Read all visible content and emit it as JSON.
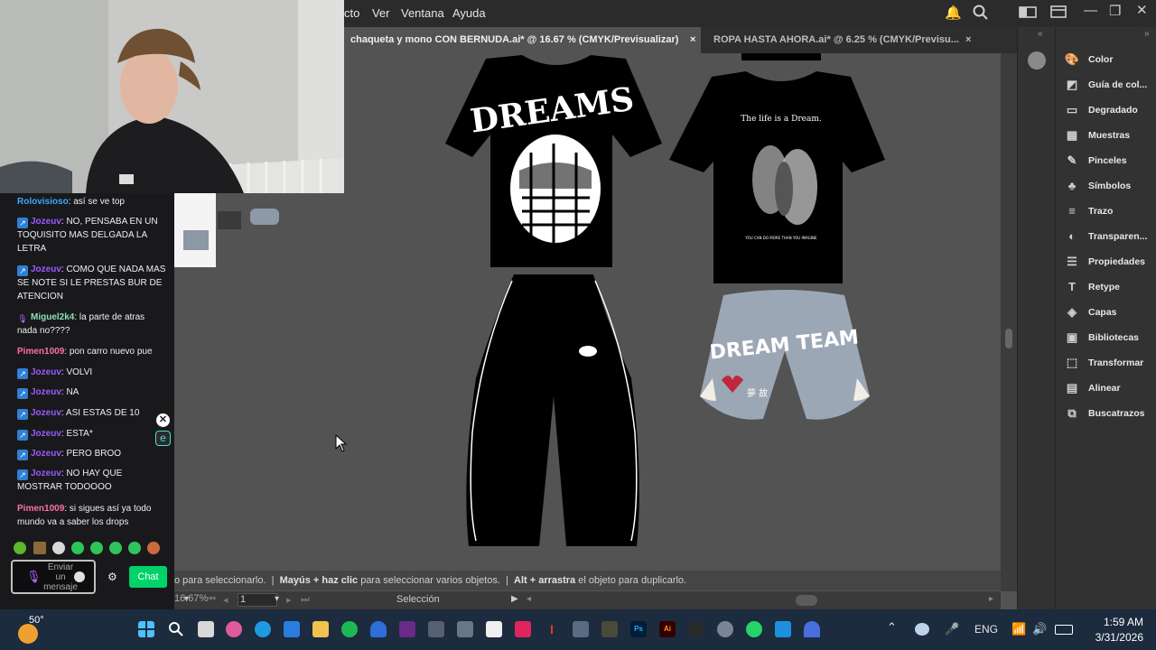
{
  "menubar": {
    "items": [
      "cto",
      "Ver",
      "Ventana",
      "Ayuda"
    ]
  },
  "tabs": [
    {
      "label": "chaqueta y mono CON BERNUDA.ai* @ 16.67 % (CMYK/Previsualizar)",
      "close": "×"
    },
    {
      "label": "ROPA HASTA AHORA.ai* @ 6.25 % (CMYK/Previsu...",
      "close": "×"
    }
  ],
  "artwork": {
    "tshirt1_text": "DREAMS",
    "tshirt2_title": "The life is a Dream.",
    "tshirt2_caption": "YOU CAN DO MORE THAN YOU IMAGINE",
    "shorts_text": "DREAM TEAM",
    "shorts_glyphs": "夢 故"
  },
  "statusbar": {
    "part1": "o para seleccionarlo.",
    "part2_bold": "Mayús + haz clic",
    "part2": " para seleccionar varios objetos.",
    "part3_bold": "Alt + arrastra",
    "part3": " el objeto para duplicarlo."
  },
  "bottombar": {
    "zoom": "16.67%",
    "page": "1",
    "tool": "Selección"
  },
  "panel": {
    "items": [
      {
        "label": "Color",
        "icon": "palette-icon",
        "glyph": "🎨"
      },
      {
        "label": "Guía de col...",
        "icon": "color-guide-icon",
        "glyph": "◩"
      },
      {
        "label": "Degradado",
        "icon": "gradient-icon",
        "glyph": "▭"
      },
      {
        "label": "Muestras",
        "icon": "swatches-icon",
        "glyph": "▦"
      },
      {
        "label": "Pinceles",
        "icon": "brush-icon",
        "glyph": "✎"
      },
      {
        "label": "Símbolos",
        "icon": "symbols-icon",
        "glyph": "♣"
      },
      {
        "label": "Trazo",
        "icon": "stroke-icon",
        "glyph": "≡"
      },
      {
        "label": "Transparen...",
        "icon": "transparency-icon",
        "glyph": "◐"
      },
      {
        "label": "Propiedades",
        "icon": "properties-icon",
        "glyph": "☰"
      },
      {
        "label": "Retype",
        "icon": "retype-icon",
        "glyph": "T"
      },
      {
        "label": "Capas",
        "icon": "layers-icon",
        "glyph": "◈"
      },
      {
        "label": "Bibliotecas",
        "icon": "libraries-icon",
        "glyph": "▣"
      },
      {
        "label": "Transformar",
        "icon": "transform-icon",
        "glyph": "⬚"
      },
      {
        "label": "Alinear",
        "icon": "align-icon",
        "glyph": "▤"
      },
      {
        "label": "Buscatrazos",
        "icon": "pathfinder-icon",
        "glyph": "⧉"
      }
    ]
  },
  "chat": {
    "messages": [
      {
        "user": "Rolovisioso",
        "user_class": "u-rolo",
        "badge": "",
        "text": ": así se ve top"
      },
      {
        "user": "Jozeuv",
        "user_class": "u-jozeuv",
        "badge": "sub",
        "text": ": NO, PENSABA EN UN TOQUISITO MAS DELGADA LA LETRA"
      },
      {
        "user": "Jozeuv",
        "user_class": "u-jozeuv",
        "badge": "sub",
        "text": ": COMO QUE NADA MAS SE NOTE SI LE PRESTAS BUR DE ATENCION"
      },
      {
        "user": "Miguel2k4",
        "user_class": "u-miguel",
        "badge": "mic",
        "text": ": la parte de atras nada no????"
      },
      {
        "user": "Pimen1009",
        "user_class": "u-pimen",
        "badge": "",
        "text": ": pon carro nuevo pue"
      },
      {
        "user": "Jozeuv",
        "user_class": "u-jozeuv",
        "badge": "sub",
        "text": ": VOLVI"
      },
      {
        "user": "Jozeuv",
        "user_class": "u-jozeuv",
        "badge": "sub",
        "text": ": NA"
      },
      {
        "user": "Jozeuv",
        "user_class": "u-jozeuv",
        "badge": "sub",
        "text": ": ASI ESTAS DE 10"
      },
      {
        "user": "Jozeuv",
        "user_class": "u-jozeuv",
        "badge": "sub",
        "text": ": ESTA*"
      },
      {
        "user": "Jozeuv",
        "user_class": "u-jozeuv",
        "badge": "sub",
        "text": ": PERO BROO"
      },
      {
        "user": "Jozeuv",
        "user_class": "u-jozeuv",
        "badge": "sub",
        "text": ": NO HAY QUE MOSTRAR TODOOOO"
      },
      {
        "user": "Pimen1009",
        "user_class": "u-pimen",
        "badge": "",
        "text": ": si sigues así ya todo mundo va a saber los drops"
      }
    ],
    "input_placeholder": "Enviar un mensaje",
    "send_label": "Chat",
    "close_glyph": "✕",
    "ext_glyph": "e"
  },
  "taskbar": {
    "weather_temp": "50°",
    "language": "ENG",
    "time": "1:59 AM",
    "date": "3/31/2026"
  }
}
